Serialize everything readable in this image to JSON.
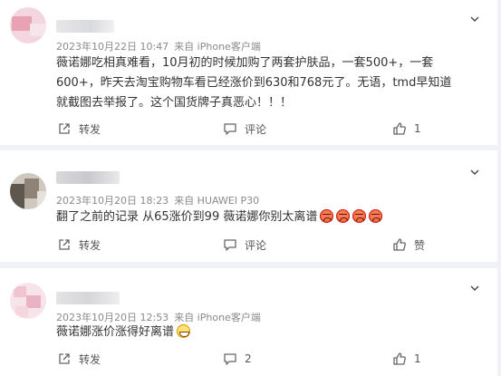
{
  "comments": [
    {
      "date": "2023年10月22日 10:47",
      "source": "来自 iPhone客户端",
      "text": "薇诺娜吃相真难看，10月初的时候加购了两套护肤品，一套500+，一套600+，昨天去淘宝购物车看已经涨价到630和768元了。无语，tmd早知道就截图去举报了。这个国货牌子真恶心！！！",
      "share_label": "转发",
      "comment_label": "评论",
      "like_label": "1"
    },
    {
      "date": "2023年10月20日 18:23",
      "source": "来自 HUAWEI P30",
      "text": "翻了之前的记录 从65涨价到99 薇诺娜你别太离谱",
      "emojis": [
        "angry-emoji",
        "angry-emoji",
        "angry-emoji",
        "angry-emoji"
      ],
      "share_label": "转发",
      "comment_label": "评论",
      "like_label": "赞"
    },
    {
      "date": "2023年10月20日 12:53",
      "source": "来自 iPhone客户端",
      "text": "薇诺娜涨价涨得好离谱",
      "emojis": [
        "grin-emoji"
      ],
      "share_label": "转发",
      "comment_label": "2",
      "like_label": "1"
    }
  ],
  "icons": {
    "share": "share-icon",
    "comment": "comment-icon",
    "like": "thumbs-up-icon",
    "more": "chevron-down-icon"
  },
  "colors": {
    "text": "#333333",
    "meta": "#8a8a8a",
    "divider": "#ececec",
    "background": "#f1f2f5"
  }
}
